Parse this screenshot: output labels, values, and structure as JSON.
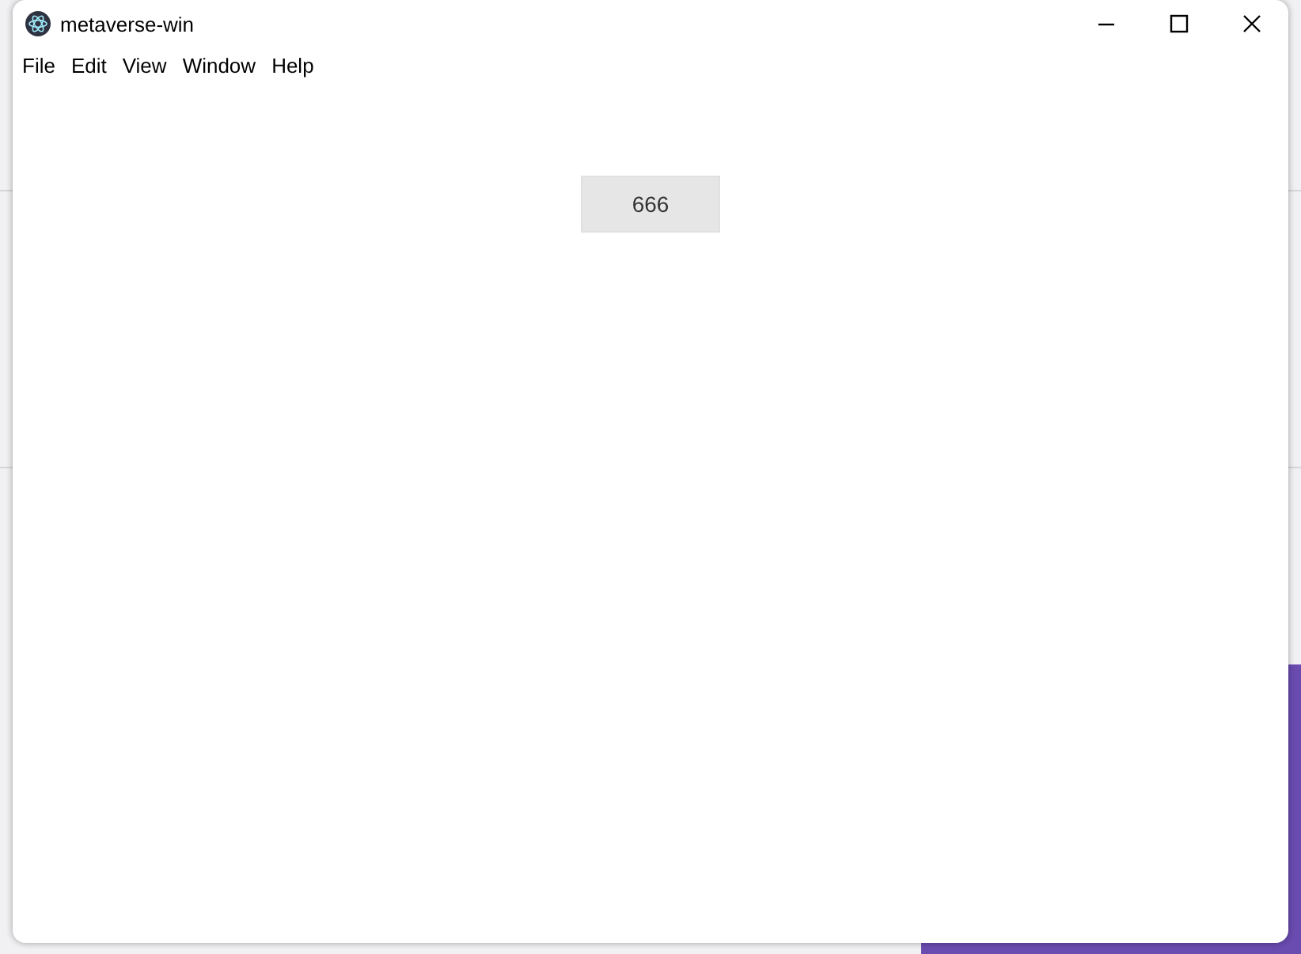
{
  "window": {
    "title": "metaverse-win"
  },
  "menu": [
    "File",
    "Edit",
    "View",
    "Window",
    "Help"
  ],
  "content": {
    "button": "666"
  }
}
